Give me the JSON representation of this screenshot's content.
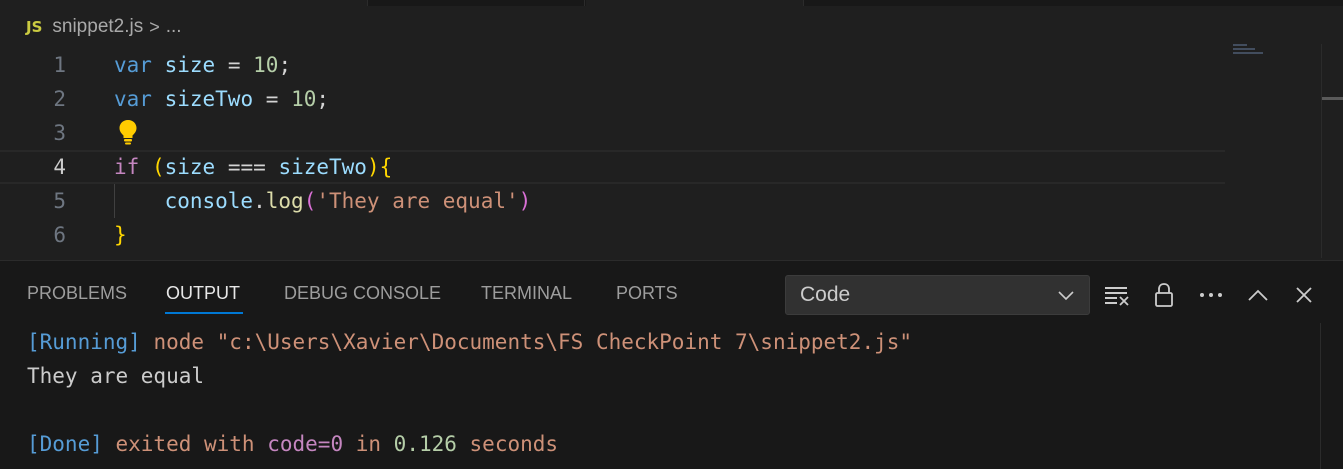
{
  "breadcrumb": {
    "file_icon": "JS",
    "file_name": "snippet2.js",
    "separator": ">",
    "more": "..."
  },
  "editor": {
    "lines": [
      {
        "number": "1",
        "tokens": {
          "kw": "var",
          "name": "size",
          "op": "=",
          "num": "10",
          "end": ";"
        }
      },
      {
        "number": "2",
        "tokens": {
          "kw": "var",
          "name": "sizeTwo",
          "op": "=",
          "num": "10",
          "end": ";"
        }
      },
      {
        "number": "3"
      },
      {
        "number": "4",
        "tokens": {
          "kw": "if",
          "open": "(",
          "a": "size",
          "op": "===",
          "b": "sizeTwo",
          "close": ")",
          "brace": "{"
        }
      },
      {
        "number": "5",
        "tokens": {
          "obj": "console",
          "dot": ".",
          "fn": "log",
          "open": "(",
          "str": "'They are equal'",
          "close": ")"
        }
      },
      {
        "number": "6",
        "tokens": {
          "brace": "}"
        }
      }
    ],
    "lightbulb_icon": "lightbulb-icon"
  },
  "panel": {
    "tabs": [
      {
        "label": "PROBLEMS",
        "active": false
      },
      {
        "label": "OUTPUT",
        "active": true
      },
      {
        "label": "DEBUG CONSOLE",
        "active": false
      },
      {
        "label": "TERMINAL",
        "active": false
      },
      {
        "label": "PORTS",
        "active": false
      }
    ],
    "channel_select": "Code",
    "toolbar_icons": [
      "clear-output-icon",
      "lock-icon",
      "more-icon",
      "maximize-icon",
      "close-icon"
    ],
    "output": {
      "line1": {
        "tag": "[Running]",
        "cmd": " node \"c:\\Users\\Xavier\\Documents\\FS CheckPoint 7\\snippet2.js\""
      },
      "line2": "They are equal",
      "line4": {
        "tag": "[Done]",
        "pre": " exited with ",
        "code": "code=0",
        "mid": " in ",
        "time": "0.126",
        "post": " seconds"
      }
    }
  },
  "colors": {
    "background": "#1f1f1f",
    "panel_background": "#181818",
    "accent": "#0078d4",
    "keyword": "#569cd6",
    "control": "#c586c0",
    "variable": "#9cdcfe",
    "number": "#b5cea8",
    "string": "#ce9178",
    "function": "#dcdcaa",
    "bracket": "#ffd700",
    "bracket_nested": "#da70d6"
  }
}
